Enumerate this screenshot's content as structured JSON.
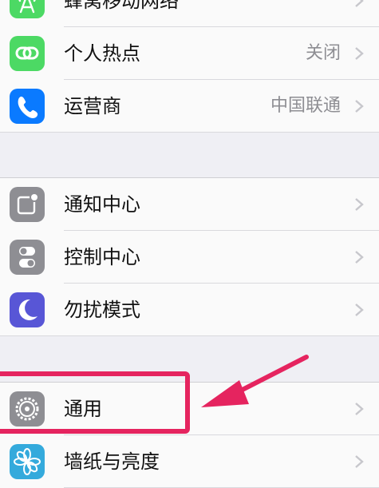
{
  "settings": {
    "group1": [
      {
        "label": "蜂窝移动网络",
        "value": "",
        "icon": "cellular-antenna-icon",
        "color": "#4cd964"
      },
      {
        "label": "个人热点",
        "value": "关闭",
        "icon": "hotspot-link-icon",
        "color": "#4cd964"
      },
      {
        "label": "运营商",
        "value": "中国联通",
        "icon": "phone-handset-icon",
        "color": "#0a7aff"
      }
    ],
    "group2": [
      {
        "label": "通知中心",
        "value": "",
        "icon": "notification-center-icon",
        "color": "#8e8e93"
      },
      {
        "label": "控制中心",
        "value": "",
        "icon": "control-center-toggle-icon",
        "color": "#8e8e93"
      },
      {
        "label": "勿扰模式",
        "value": "",
        "icon": "moon-icon",
        "color": "#5856d6"
      }
    ],
    "group3": [
      {
        "label": "通用",
        "value": "",
        "icon": "gear-icon",
        "color": "#8e8e93"
      },
      {
        "label": "墙纸与亮度",
        "value": "",
        "icon": "flower-icon",
        "color": "#34aadc"
      }
    ]
  },
  "annotation": {
    "highlight_color": "#e5245f"
  }
}
